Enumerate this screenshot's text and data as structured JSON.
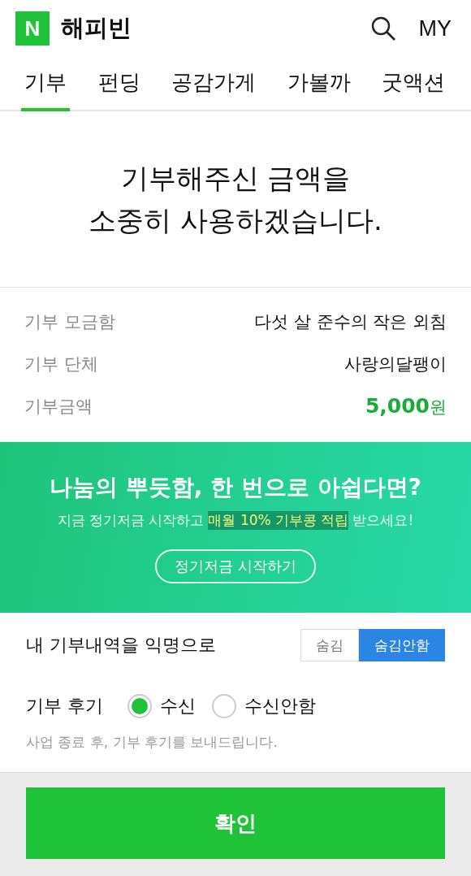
{
  "header": {
    "logo": "N",
    "title": "해피빈",
    "my": "MY"
  },
  "tabs": [
    {
      "label": "기부",
      "selected": true
    },
    {
      "label": "펀딩",
      "selected": false
    },
    {
      "label": "공감가게",
      "selected": false
    },
    {
      "label": "가볼까",
      "selected": false
    },
    {
      "label": "굿액션",
      "selected": false
    }
  ],
  "heading": [
    "기부해주신 금액을",
    "소중히 사용하겠습니다."
  ],
  "details": [
    {
      "label": "기부 모금함",
      "value": "다섯 살 준수의 작은 외침",
      "kind": "text"
    },
    {
      "label": "기부 단체",
      "value": "사랑의달팽이",
      "kind": "text"
    },
    {
      "label": "기부금액",
      "value": "5,000",
      "unit": "원",
      "kind": "amount"
    }
  ],
  "banner": {
    "title": "나눔의 뿌듯함, 한 번으로 아쉽다면?",
    "subtitle_before": "지금 정기저금 시작하고",
    "subtitle_highlight": "매월 10% 기부콩 적립",
    "subtitle_after": "받으세요!",
    "button": "정기저금 시작하기"
  },
  "anonymous": {
    "label": "내 기부내역을 익명으로",
    "options": [
      {
        "label": "숨김",
        "selected": false
      },
      {
        "label": "숨김안함",
        "selected": true
      }
    ]
  },
  "review": {
    "label": "기부 후기",
    "options": [
      {
        "label": "수신",
        "selected": true
      },
      {
        "label": "수신안함",
        "selected": false
      }
    ],
    "note": "사업 종료 후, 기부 후기를 보내드립니다."
  },
  "confirm": "확인"
}
